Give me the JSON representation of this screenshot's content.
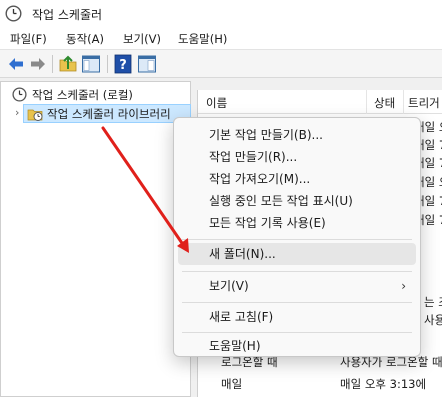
{
  "window": {
    "title": "작업 스케줄러",
    "icon": "clock-icon"
  },
  "menubar": [
    {
      "label": "파일(F)"
    },
    {
      "label": "동작(A)"
    },
    {
      "label": "보기(V)"
    },
    {
      "label": "도움말(H)"
    }
  ],
  "toolbar": {
    "icons": [
      "back-arrow-icon",
      "forward-arrow-icon",
      "folder-up-icon",
      "show-hide-tree-icon",
      "help-icon",
      "show-action-pane-icon"
    ]
  },
  "tree": {
    "root_label": "작업 스케줄러 (로컬)",
    "child_label": "작업 스케줄러 라이브러리"
  },
  "list": {
    "columns": [
      "이름",
      "상태",
      "트리거"
    ],
    "trigger_cells": [
      "매일 오",
      "매일 7",
      "매일 7",
      "매일 오",
      "매일 7",
      "매일 7"
    ],
    "partial_texts": [
      "는 조",
      "사용"
    ],
    "bottom_rows": [
      {
        "trigger": "로그온할 때",
        "detail": "사용자가 로그온할 때"
      },
      {
        "trigger": "매일",
        "detail": "매일 오후 3:13에"
      }
    ]
  },
  "context_menu": {
    "group1": [
      "기본 작업 만들기(B)...",
      "작업 만들기(R)...",
      "작업 가져오기(M)...",
      "실행 중인 모든 작업 표시(U)",
      "모든 작업 기록 사용(E)"
    ],
    "new_folder": "새 폴더(N)...",
    "view": "보기(V)",
    "refresh": "새로 고침(F)",
    "help": "도움말(H)"
  },
  "colors": {
    "selection_bg": "#cce8ff",
    "highlight_bg": "#e6e6e6",
    "annotation_arrow": "#e0201b"
  }
}
